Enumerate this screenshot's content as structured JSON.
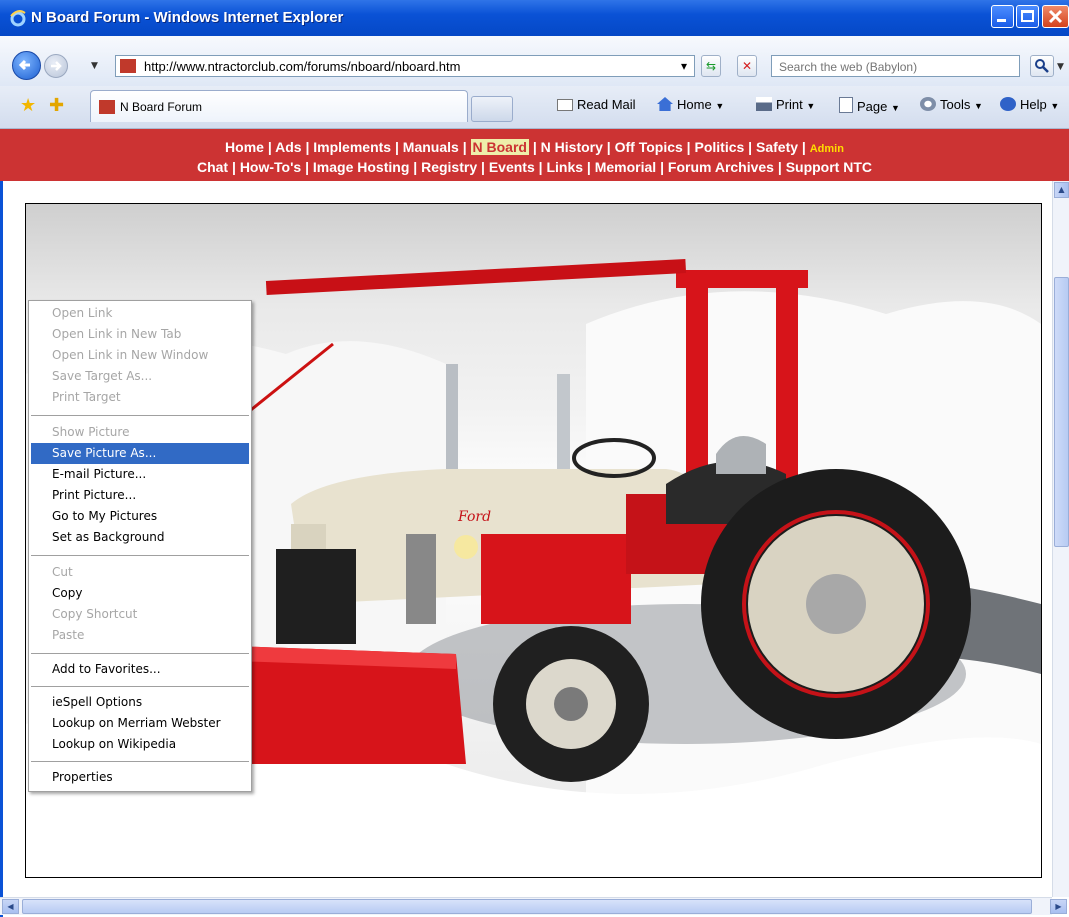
{
  "window": {
    "title": "N Board Forum - Windows Internet Explorer"
  },
  "address": {
    "url": "http://www.ntractorclub.com/forums/nboard/nboard.htm"
  },
  "search": {
    "placeholder": "Search the web (Babylon)"
  },
  "tab": {
    "label": "N Board Forum"
  },
  "commands": {
    "read_mail": "Read Mail",
    "home": "Home",
    "print": "Print",
    "page": "Page",
    "tools": "Tools",
    "help": "Help"
  },
  "site_nav": {
    "home": "Home",
    "ads": "Ads",
    "implements": "Implements",
    "manuals": "Manuals",
    "nboard": "N Board",
    "nhistory": "N History",
    "offtopics": "Off Topics",
    "politics": "Politics",
    "safety": "Safety",
    "admin": "Admin",
    "chat": "Chat",
    "howtos": "How-To's",
    "imagehosting": "Image Hosting",
    "registry": "Registry",
    "events": "Events",
    "links": "Links",
    "memorial": "Memorial",
    "archives": "Forum Archives",
    "support": "Support NTC",
    "sep": " | "
  },
  "context_menu": {
    "items": [
      {
        "label": "Open Link",
        "enabled": false
      },
      {
        "label": "Open Link in New Tab",
        "enabled": false
      },
      {
        "label": "Open Link in New Window",
        "enabled": false
      },
      {
        "label": "Save Target As...",
        "enabled": false
      },
      {
        "label": "Print Target",
        "enabled": false
      },
      {
        "label": "Show Picture",
        "enabled": false
      },
      {
        "label": "Save Picture As...",
        "enabled": true,
        "selected": true
      },
      {
        "label": "E-mail Picture...",
        "enabled": true
      },
      {
        "label": "Print Picture...",
        "enabled": true
      },
      {
        "label": "Go to My Pictures",
        "enabled": true
      },
      {
        "label": "Set as Background",
        "enabled": true
      },
      {
        "label": "Cut",
        "enabled": false
      },
      {
        "label": "Copy",
        "enabled": true
      },
      {
        "label": "Copy Shortcut",
        "enabled": false
      },
      {
        "label": "Paste",
        "enabled": false
      },
      {
        "label": "Add to Favorites...",
        "enabled": true
      },
      {
        "label": "ieSpell Options",
        "enabled": true
      },
      {
        "label": "Lookup on Merriam Webster",
        "enabled": true
      },
      {
        "label": "Lookup on Wikipedia",
        "enabled": true
      },
      {
        "label": "Properties",
        "enabled": true
      }
    ]
  },
  "photo": {
    "emblem_text": "Ford"
  },
  "colors": {
    "site_nav_bg": "#cc3333",
    "menu_highlight": "#316ac5",
    "tractor_red": "#d7141a",
    "arrow": "#cc1111"
  }
}
